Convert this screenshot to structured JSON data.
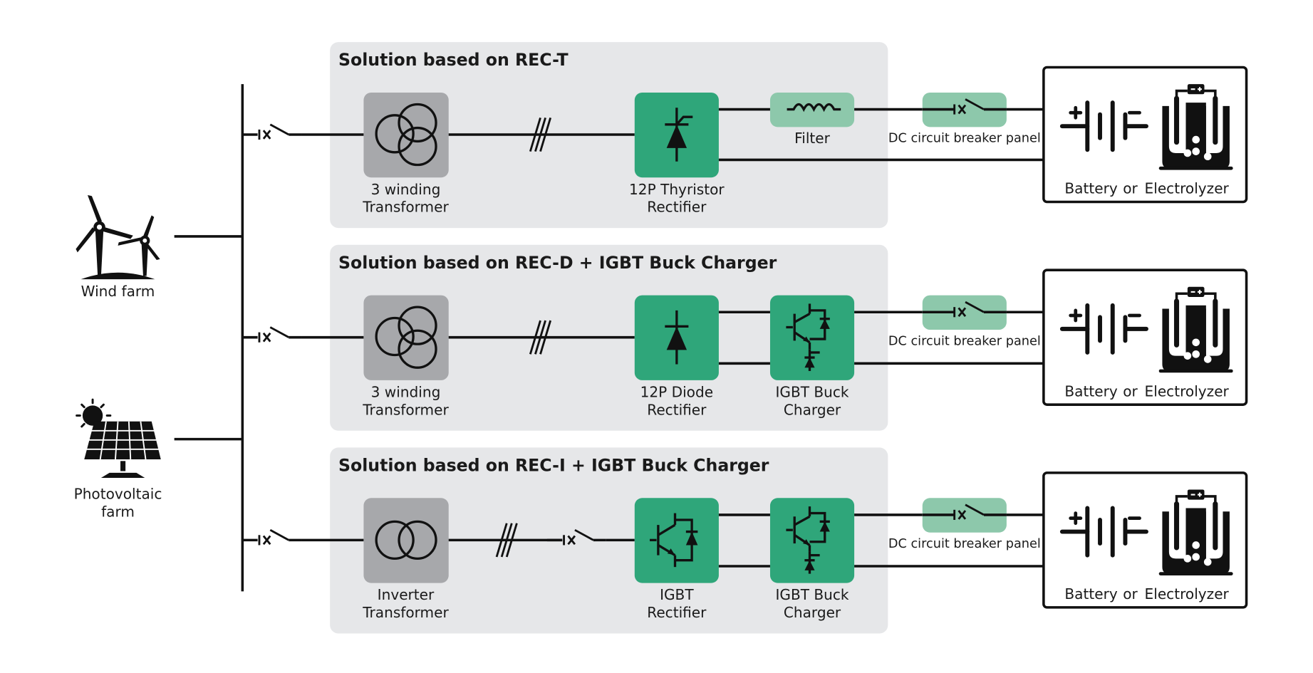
{
  "colors": {
    "panel_background": "#e6e7e9",
    "transformer_box": "#a7a8ab",
    "converter_box": "#2fa67a",
    "filter_breaker_box": "#8dc8ab",
    "line": "#111111"
  },
  "sources": {
    "wind": {
      "label": "Wind farm",
      "icon": "wind-turbine-icon"
    },
    "pv": {
      "label_line1": "Photovoltaic",
      "label_line2": "farm",
      "icon": "solar-panel-icon"
    }
  },
  "solutions": [
    {
      "title": "Solution based on REC-T",
      "transformer": {
        "line1": "3 winding",
        "line2": "Transformer",
        "icon": "three-winding-transformer-icon"
      },
      "rectifier": {
        "line1": "12P Thyristor",
        "line2": "Rectifier",
        "icon": "thyristor-icon"
      },
      "second_stage": {
        "line1": "Filter",
        "icon": "inductor-icon"
      },
      "dc_breaker": {
        "label": "DC circuit breaker panel",
        "icon": "dc-breaker-icon"
      },
      "load": {
        "battery": "Battery",
        "or": "or",
        "electrolyzer": "Electrolyzer"
      }
    },
    {
      "title": "Solution based on REC-D + IGBT Buck Charger",
      "transformer": {
        "line1": "3 winding",
        "line2": "Transformer",
        "icon": "three-winding-transformer-icon"
      },
      "rectifier": {
        "line1": "12P Diode",
        "line2": "Rectifier",
        "icon": "diode-icon"
      },
      "second_stage": {
        "line1": "IGBT Buck",
        "line2": "Charger",
        "icon": "igbt-buck-icon"
      },
      "dc_breaker": {
        "label": "DC circuit breaker panel",
        "icon": "dc-breaker-icon"
      },
      "load": {
        "battery": "Battery",
        "or": "or",
        "electrolyzer": "Electrolyzer"
      }
    },
    {
      "title": "Solution based on REC-I + IGBT Buck Charger",
      "transformer": {
        "line1": "Inverter",
        "line2": "Transformer",
        "icon": "two-winding-transformer-icon"
      },
      "rectifier": {
        "line1": "IGBT",
        "line2": "Rectifier",
        "icon": "igbt-icon"
      },
      "second_stage": {
        "line1": "IGBT Buck",
        "line2": "Charger",
        "icon": "igbt-buck-icon"
      },
      "dc_breaker": {
        "label": "DC circuit breaker panel",
        "icon": "dc-breaker-icon"
      },
      "load": {
        "battery": "Battery",
        "or": "or",
        "electrolyzer": "Electrolyzer"
      }
    }
  ]
}
